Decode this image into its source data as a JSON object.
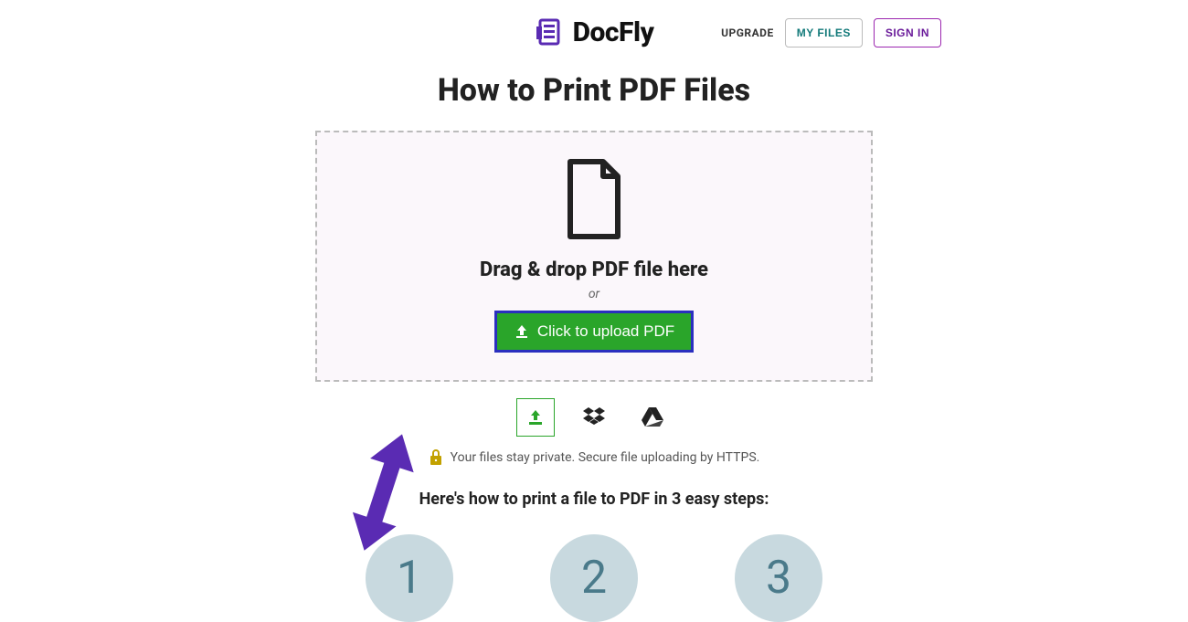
{
  "header": {
    "brand": "DocFly",
    "upgrade": "UPGRADE",
    "myFiles": "MY FILES",
    "signIn": "SIGN IN"
  },
  "page": {
    "title": "How to Print PDF Files"
  },
  "dropzone": {
    "dragText": "Drag & drop PDF file here",
    "or": "or",
    "uploadButton": "Click to upload PDF"
  },
  "privacy": {
    "text": "Your files stay private. Secure file uploading by HTTPS."
  },
  "steps": {
    "heading": "Here's how to print a file to PDF in 3 easy steps:",
    "numbers": [
      "1",
      "2",
      "3"
    ]
  }
}
